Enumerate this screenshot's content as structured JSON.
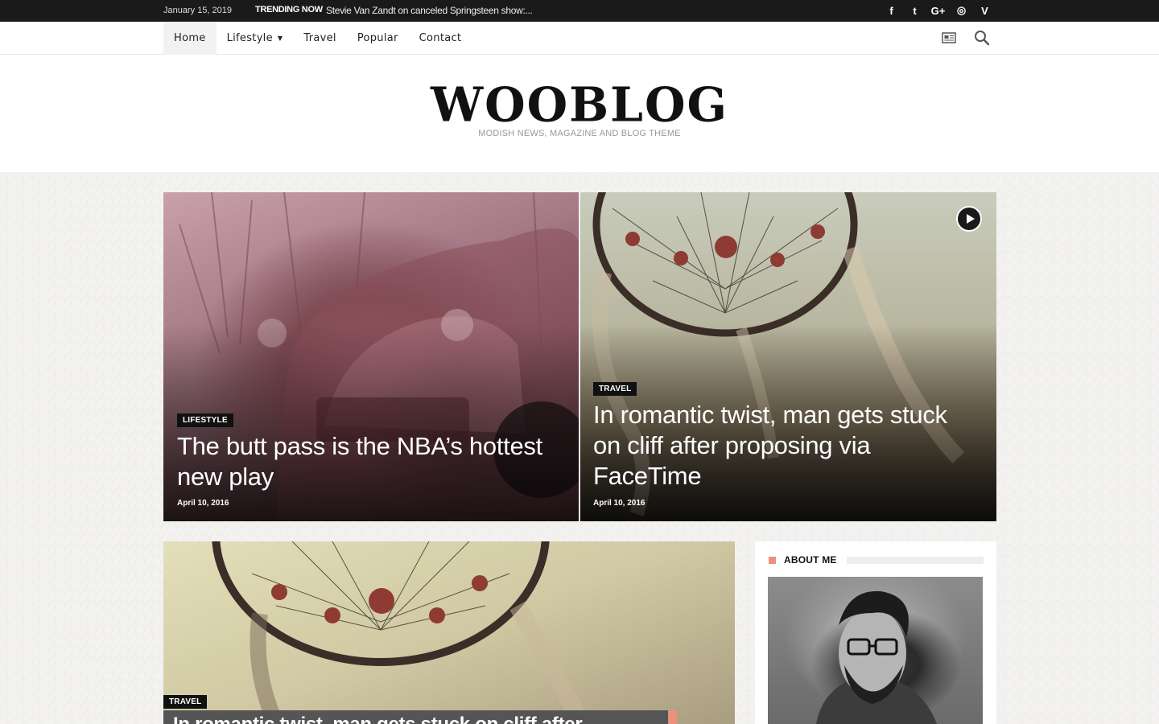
{
  "topbar": {
    "date": "January 15, 2019",
    "trending_label": "TRENDING NOW",
    "trending_text": "Stevie Van Zandt on canceled Springsteen show:...",
    "socials": [
      "facebook-icon",
      "twitter-icon",
      "google-plus-icon",
      "dribbble-icon",
      "vimeo-icon"
    ],
    "social_glyphs": [
      "f",
      "t",
      "G+",
      "◎",
      "V"
    ]
  },
  "nav": {
    "items": [
      {
        "label": "Home",
        "active": true
      },
      {
        "label": "Lifestyle",
        "has_dropdown": true
      },
      {
        "label": "Travel"
      },
      {
        "label": "Popular"
      },
      {
        "label": "Contact"
      }
    ]
  },
  "header": {
    "logo": "WOOBLOG",
    "tagline": "MODISH NEWS, MAGAZINE AND BLOG THEME"
  },
  "featured": [
    {
      "category": "LIFESTYLE",
      "title": "The butt pass is the NBA’s hottest new play",
      "date": "April 10, 2016"
    },
    {
      "category": "TRAVEL",
      "title": "In romantic twist, man gets stuck on cliff after proposing via FaceTime",
      "date": "April 10, 2016",
      "has_video": true
    }
  ],
  "main_post": {
    "category": "TRAVEL",
    "title_partial": "In romantic twist, man gets stuck on cliff after"
  },
  "sidebar": {
    "about_heading": "ABOUT ME"
  },
  "colors": {
    "accent": "#f0907c",
    "topbar_bg": "#1a1a1a",
    "badge_bg": "#111111"
  }
}
